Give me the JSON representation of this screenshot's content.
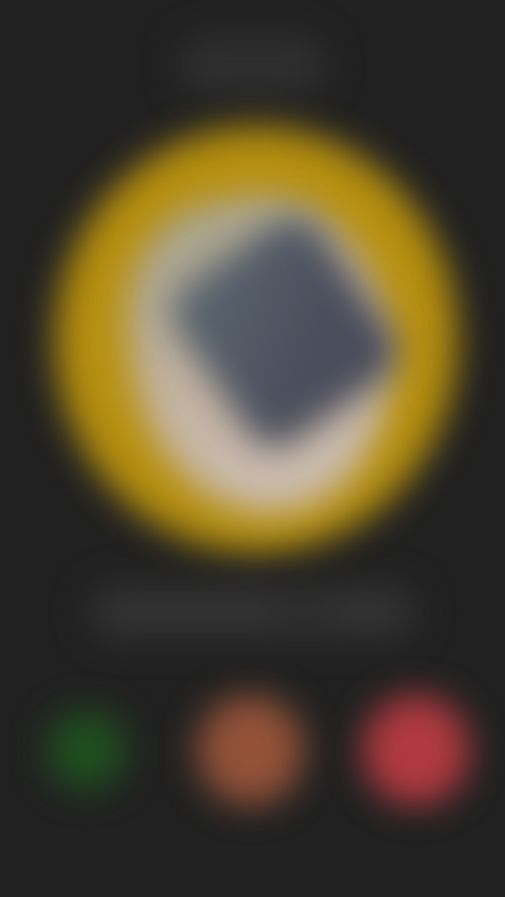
{
  "screen": {
    "caller_name": "",
    "status_text": "",
    "message_text": ""
  },
  "buttons": {
    "accept_icon": "phone-accept",
    "middle_icon": "mute",
    "decline_icon": "phone-decline"
  },
  "colors": {
    "background": "#212121",
    "avatar_ring": "#b7900f",
    "accept": "#1f4f1f",
    "middle": "#935238",
    "decline": "#b03a40"
  }
}
